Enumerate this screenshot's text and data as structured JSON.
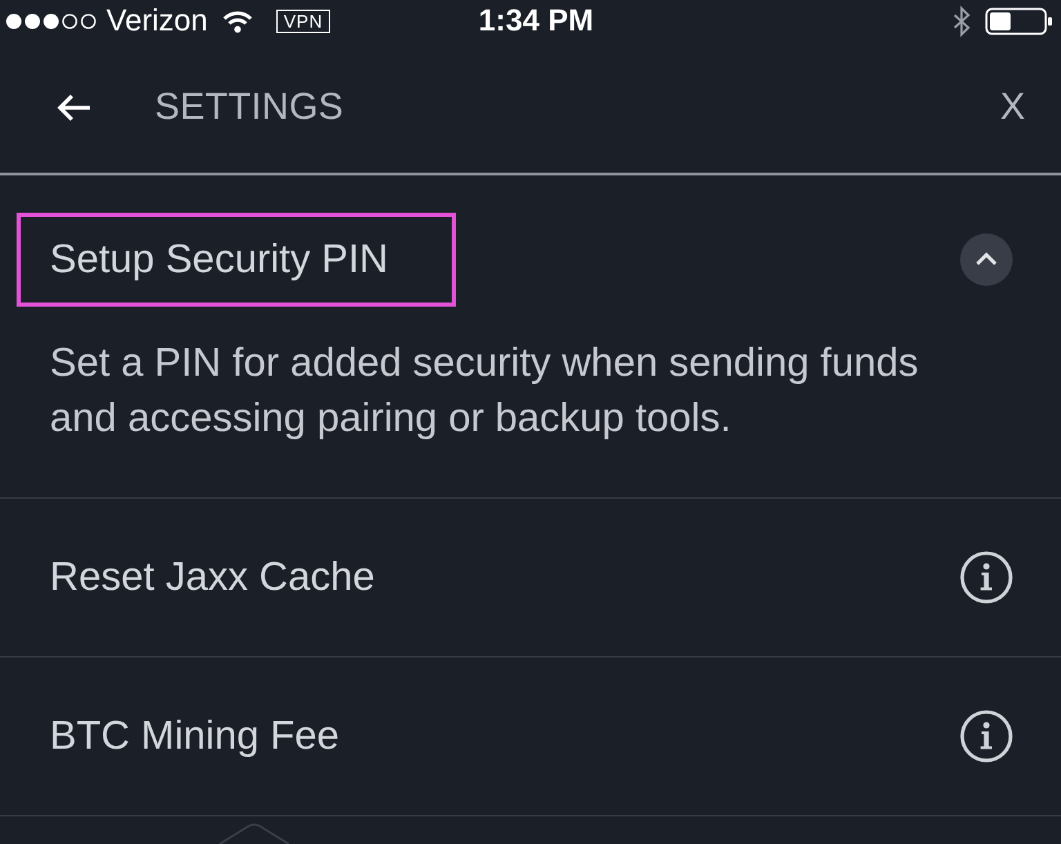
{
  "status_bar": {
    "carrier": "Verizon",
    "vpn": "VPN",
    "time": "1:34 PM"
  },
  "header": {
    "title": "SETTINGS",
    "close": "X"
  },
  "settings_items": [
    {
      "kind": "expandable",
      "label": "Setup Security PIN",
      "highlighted": true,
      "expanded": true,
      "description": "Set a PIN for added security when sending funds and accessing pairing or backup tools."
    },
    {
      "kind": "info",
      "label": "Reset Jaxx Cache"
    },
    {
      "kind": "info",
      "label": "BTC Mining Fee"
    }
  ]
}
